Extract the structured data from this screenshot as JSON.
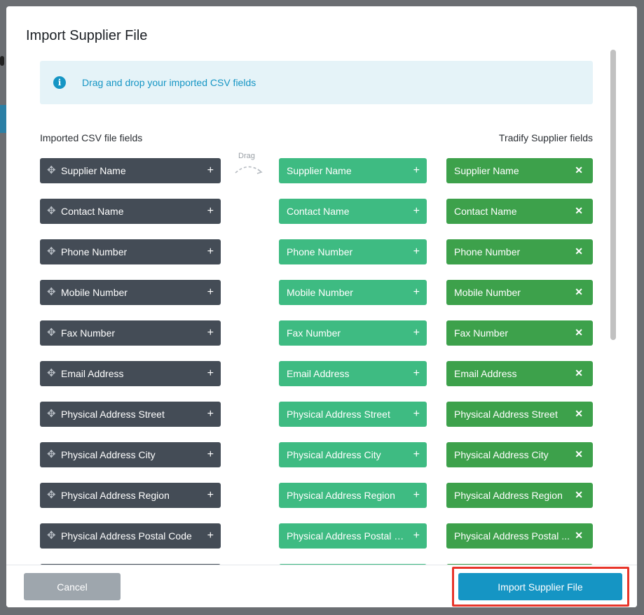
{
  "modal": {
    "title": "Import Supplier File",
    "info_text": "Drag and drop your imported CSV fields",
    "left_heading": "Imported CSV file fields",
    "right_heading": "Tradify Supplier fields",
    "drag_hint": "Drag"
  },
  "rows": [
    {
      "source": "Supplier Name",
      "mapped": "Supplier Name",
      "target": "Supplier Name"
    },
    {
      "source": "Contact Name",
      "mapped": "Contact Name",
      "target": "Contact Name"
    },
    {
      "source": "Phone Number",
      "mapped": "Phone Number",
      "target": "Phone Number"
    },
    {
      "source": "Mobile Number",
      "mapped": "Mobile Number",
      "target": "Mobile Number"
    },
    {
      "source": "Fax Number",
      "mapped": "Fax Number",
      "target": "Fax Number"
    },
    {
      "source": "Email Address",
      "mapped": "Email Address",
      "target": "Email Address"
    },
    {
      "source": "Physical Address Street",
      "mapped": "Physical Address Street",
      "target": "Physical Address Street"
    },
    {
      "source": "Physical Address City",
      "mapped": "Physical Address City",
      "target": "Physical Address City"
    },
    {
      "source": "Physical Address Region",
      "mapped": "Physical Address Region",
      "target": "Physical Address Region"
    },
    {
      "source": "Physical Address Postal Code",
      "mapped": "Physical Address Postal Co...",
      "target": "Physical Address Postal ..."
    },
    {
      "source": "",
      "mapped": "",
      "target": ""
    }
  ],
  "footer": {
    "cancel_label": "Cancel",
    "import_label": "Import Supplier File"
  },
  "icons": {
    "info": "info-icon",
    "move": "move-icon",
    "add": "plus-icon",
    "remove": "close-icon"
  },
  "colors": {
    "source_chip": "#444c56",
    "mapped_chip": "#3ebb82",
    "target_chip": "#3da14b",
    "primary": "#1595c4",
    "highlight": "#e8352a"
  }
}
